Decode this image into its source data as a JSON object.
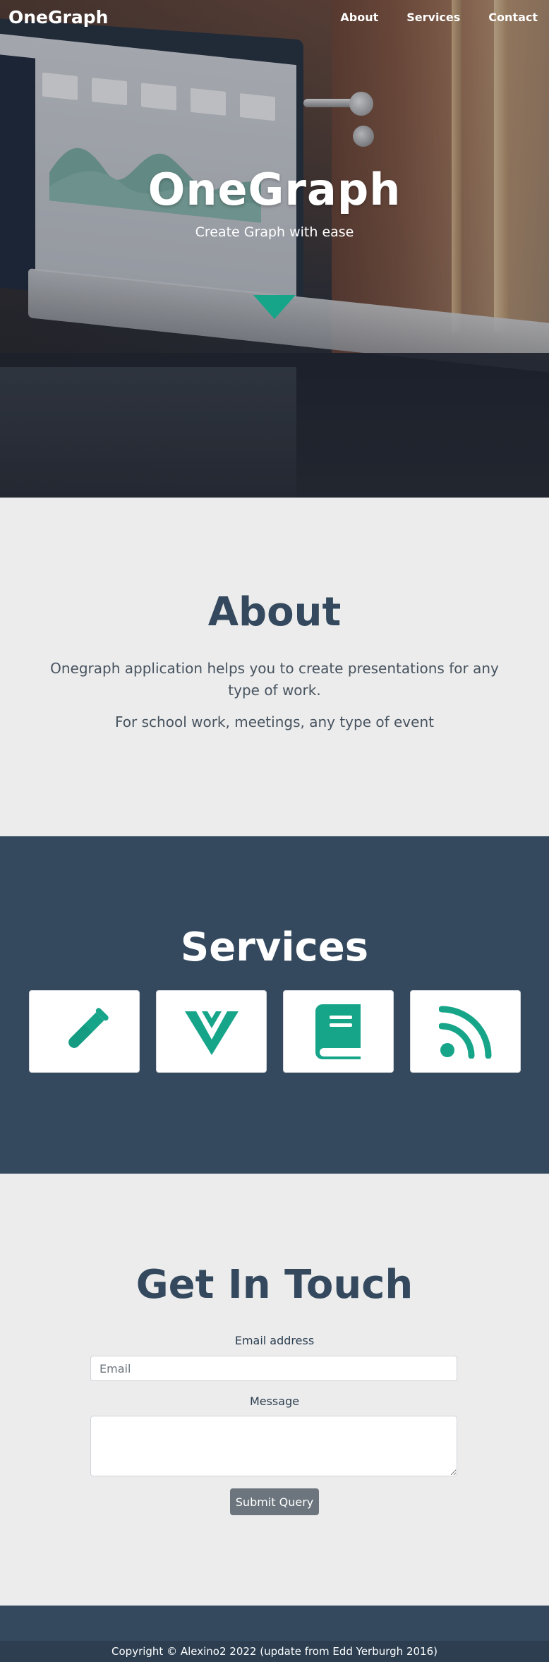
{
  "navbar": {
    "brand": "OneGraph",
    "links": [
      {
        "label": "About"
      },
      {
        "label": "Services"
      },
      {
        "label": "Contact"
      }
    ]
  },
  "hero": {
    "title": "OneGraph",
    "subtitle": "Create Graph with ease",
    "background_image": "laptop-dashboard-photo",
    "scroll_icon": "triangle-down-icon"
  },
  "about": {
    "title": "About",
    "paragraph1": "Onegraph application helps you to create presentations for any type of work.",
    "paragraph2": "For school work, meetings, any type of event"
  },
  "services": {
    "title": "Services",
    "items": [
      {
        "icon": "test-tube-icon"
      },
      {
        "icon": "vuejs-logo-icon"
      },
      {
        "icon": "book-icon"
      },
      {
        "icon": "rss-icon"
      }
    ]
  },
  "contact": {
    "title": "Get In Touch",
    "email_label": "Email address",
    "email_placeholder": "Email",
    "message_label": "Message",
    "submit_label": "Submit Query"
  },
  "footer": {
    "copyright": "Copyright © Alexino2 2022 (update from Edd Yerburgh 2016)"
  },
  "colors": {
    "accent": "#17a589",
    "dark": "#34495e",
    "light_bg": "#ececec"
  }
}
